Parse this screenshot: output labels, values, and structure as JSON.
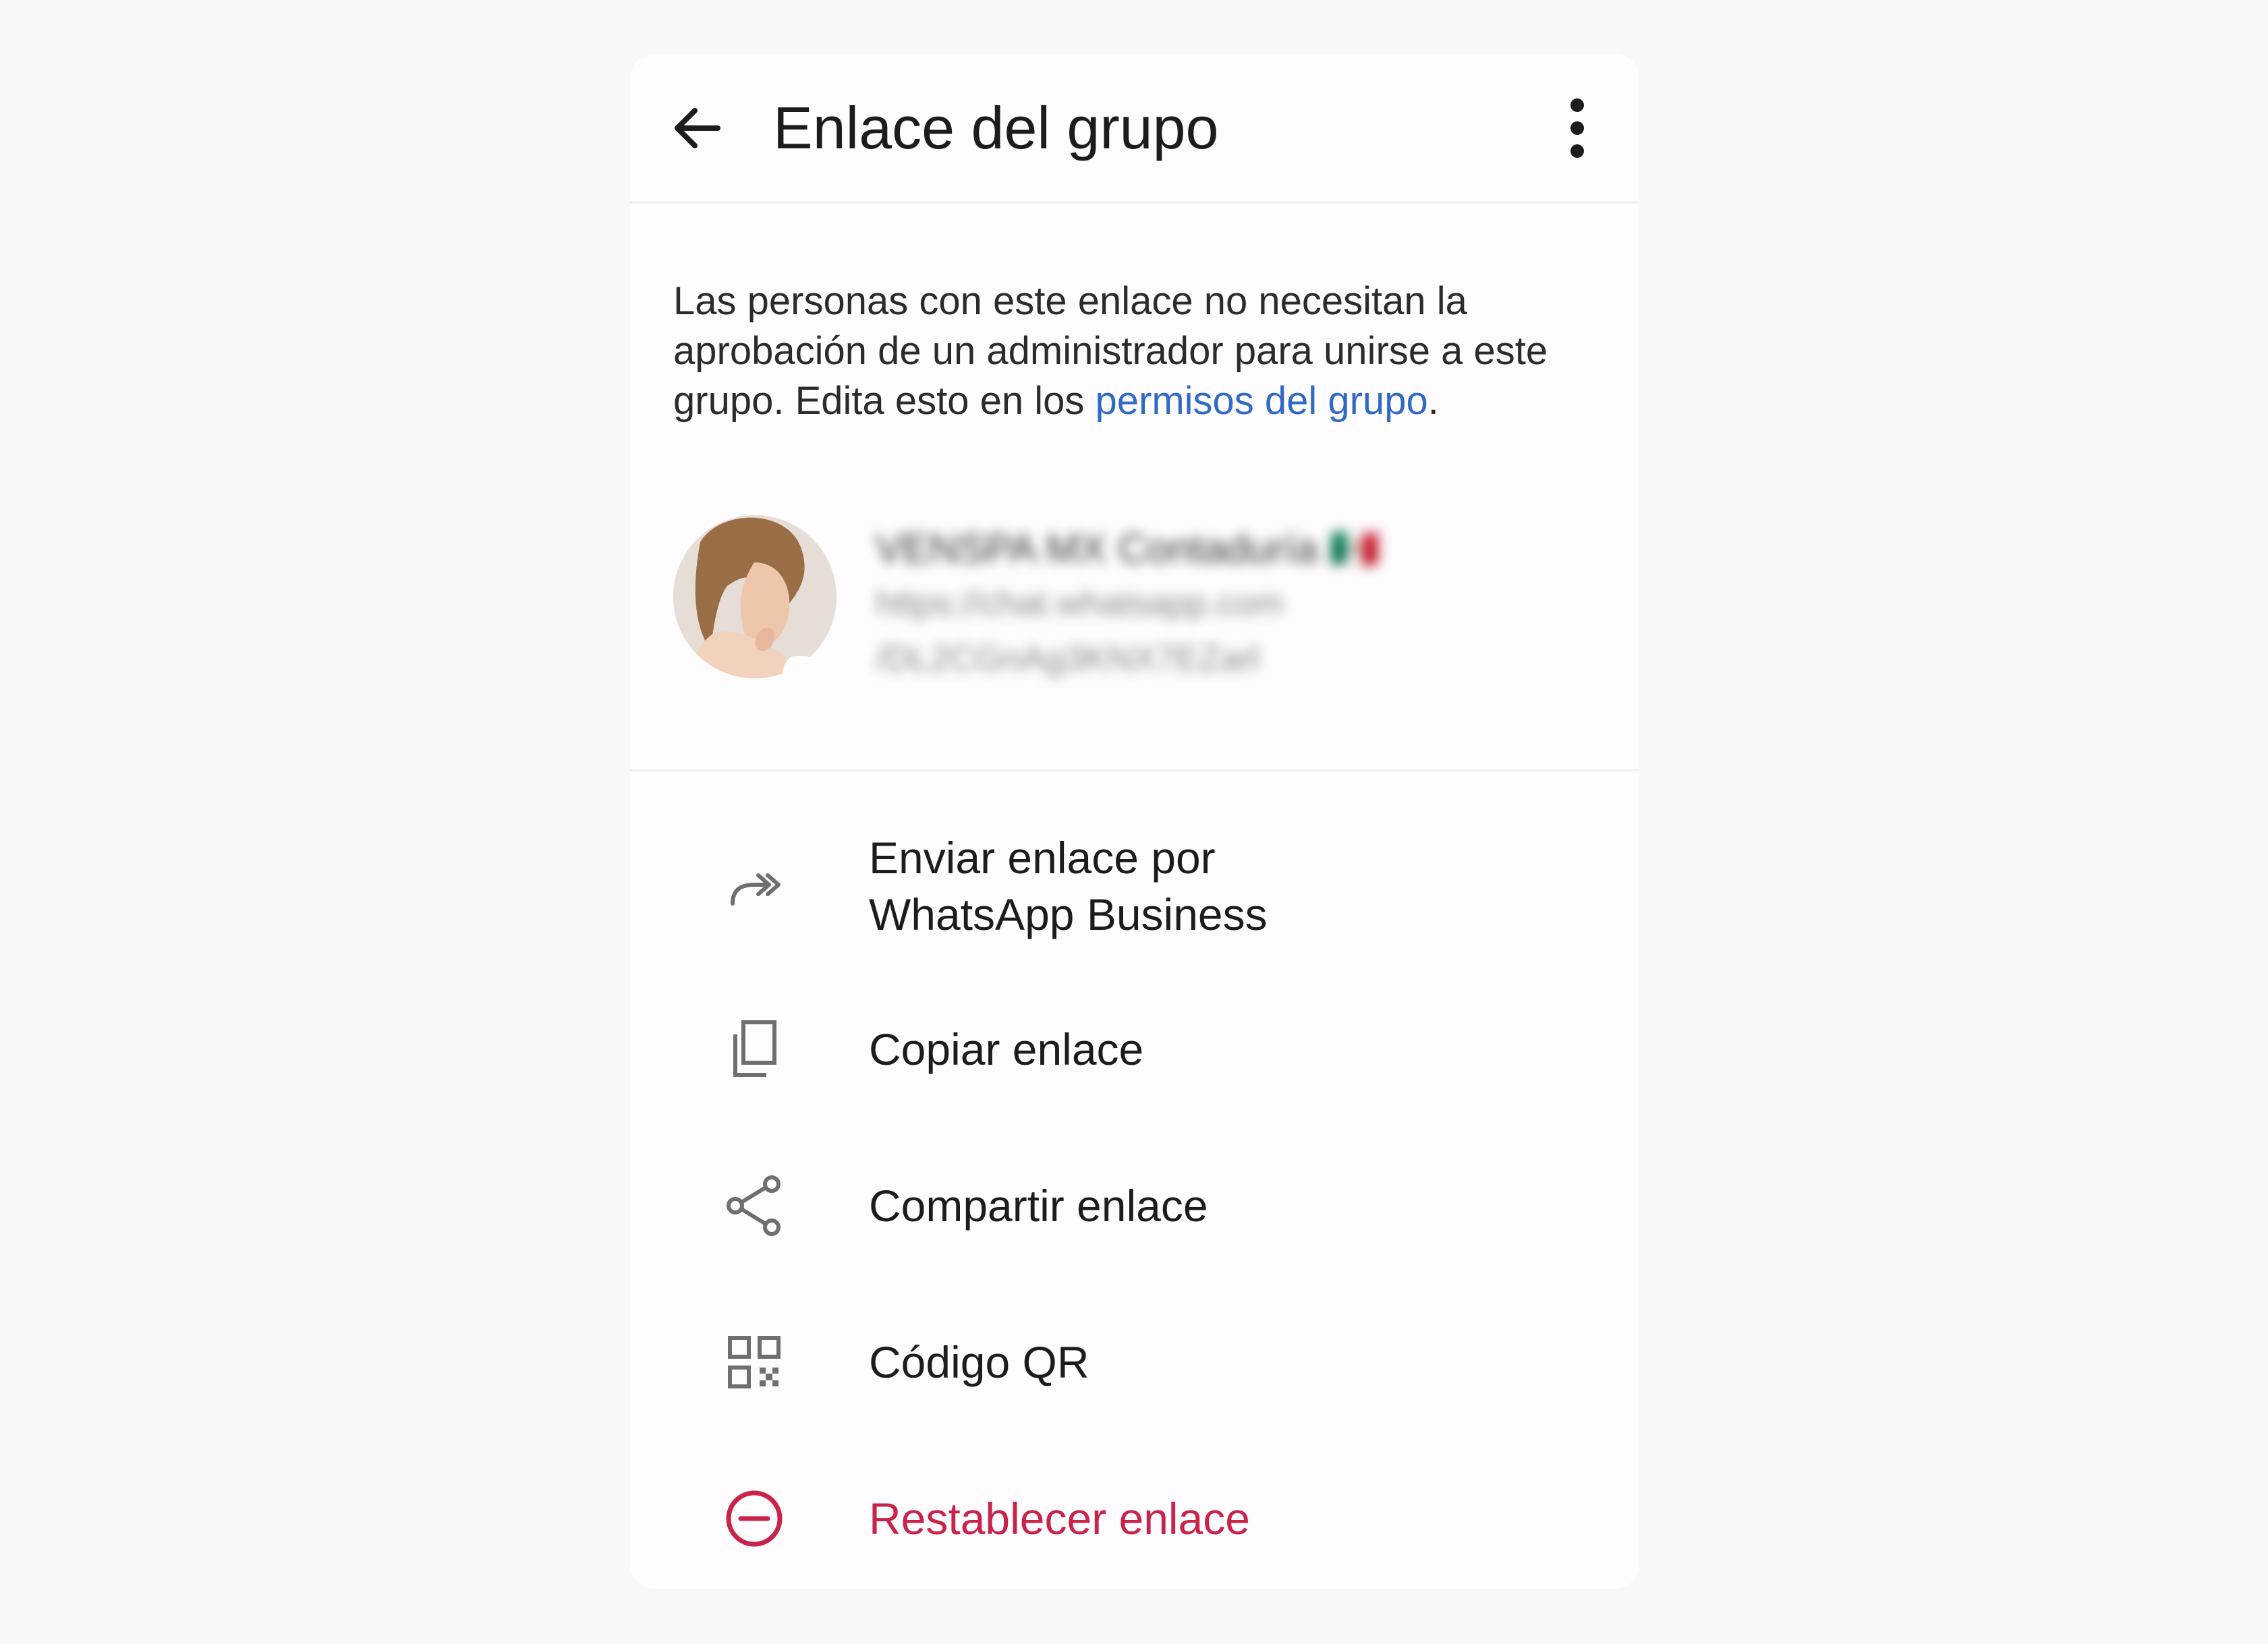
{
  "appbar": {
    "title": "Enlace del grupo"
  },
  "description": {
    "text_before_link": "Las personas con este enlace no necesitan la aprobación de un administrador para unirse a este grupo. Edita esto en los ",
    "link_text": "permisos del grupo",
    "text_after_link": "."
  },
  "group": {
    "name": "VENSPA MX Contaduría 🇲🇽",
    "link_line1": "https://chat.whatsapp.com",
    "link_line2": "/DL2CGnAg3KNX7EZarl"
  },
  "menu": {
    "items": [
      {
        "label_line1": "Enviar enlace por",
        "label_line2": "WhatsApp Business",
        "icon": "forward-icon"
      },
      {
        "label": "Copiar enlace",
        "icon": "copy-icon"
      },
      {
        "label": "Compartir enlace",
        "icon": "share-icon"
      },
      {
        "label": "Código QR",
        "icon": "qr-code-icon"
      },
      {
        "label": "Restablecer enlace",
        "icon": "reset-minus-circle-icon",
        "color": "#c9234a"
      }
    ]
  },
  "colors": {
    "background": "#f8f8fc",
    "card": "#fefcfe",
    "link": "#2f6bc4",
    "danger": "#c9234a",
    "icon_gray": "#6f6f73"
  }
}
